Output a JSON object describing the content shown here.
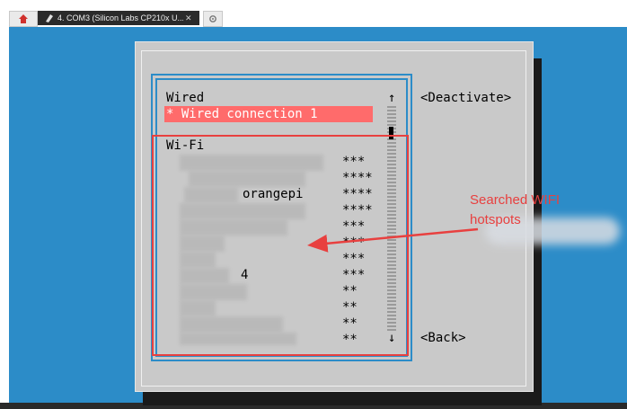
{
  "tab_bar": {
    "active_tab_title": "4. COM3  (Silicon Labs CP210x U...",
    "close_glyph": "✕"
  },
  "dialog": {
    "wired_header": "Wired",
    "wired_connection": "* Wired connection 1",
    "wifi_header": "Wi-Fi",
    "wifi_networks": [
      {
        "ssid": "",
        "signal": "***"
      },
      {
        "ssid": "",
        "signal": "****"
      },
      {
        "ssid": "orangepi",
        "signal": "****"
      },
      {
        "ssid": "",
        "signal": "****"
      },
      {
        "ssid": "",
        "signal": "***"
      },
      {
        "ssid": "",
        "signal": "***"
      },
      {
        "ssid": "",
        "signal": "***"
      },
      {
        "ssid": "4",
        "signal": "***"
      },
      {
        "ssid": "",
        "signal": "**"
      },
      {
        "ssid": "",
        "signal": "**"
      },
      {
        "ssid": "",
        "signal": "**"
      },
      {
        "ssid": "",
        "signal": "**"
      }
    ],
    "deactivate_label": "<Deactivate>",
    "back_label": "<Back>",
    "scroll_up": "↑",
    "scroll_down": "↓"
  },
  "annotation": {
    "text": "Searched WIFI\nhotspots",
    "color": "#e8403f"
  },
  "colors": {
    "terminal_bg": "#2c8cc8",
    "dialog_bg": "#c9c9c9",
    "highlight": "#ff6b6b"
  }
}
